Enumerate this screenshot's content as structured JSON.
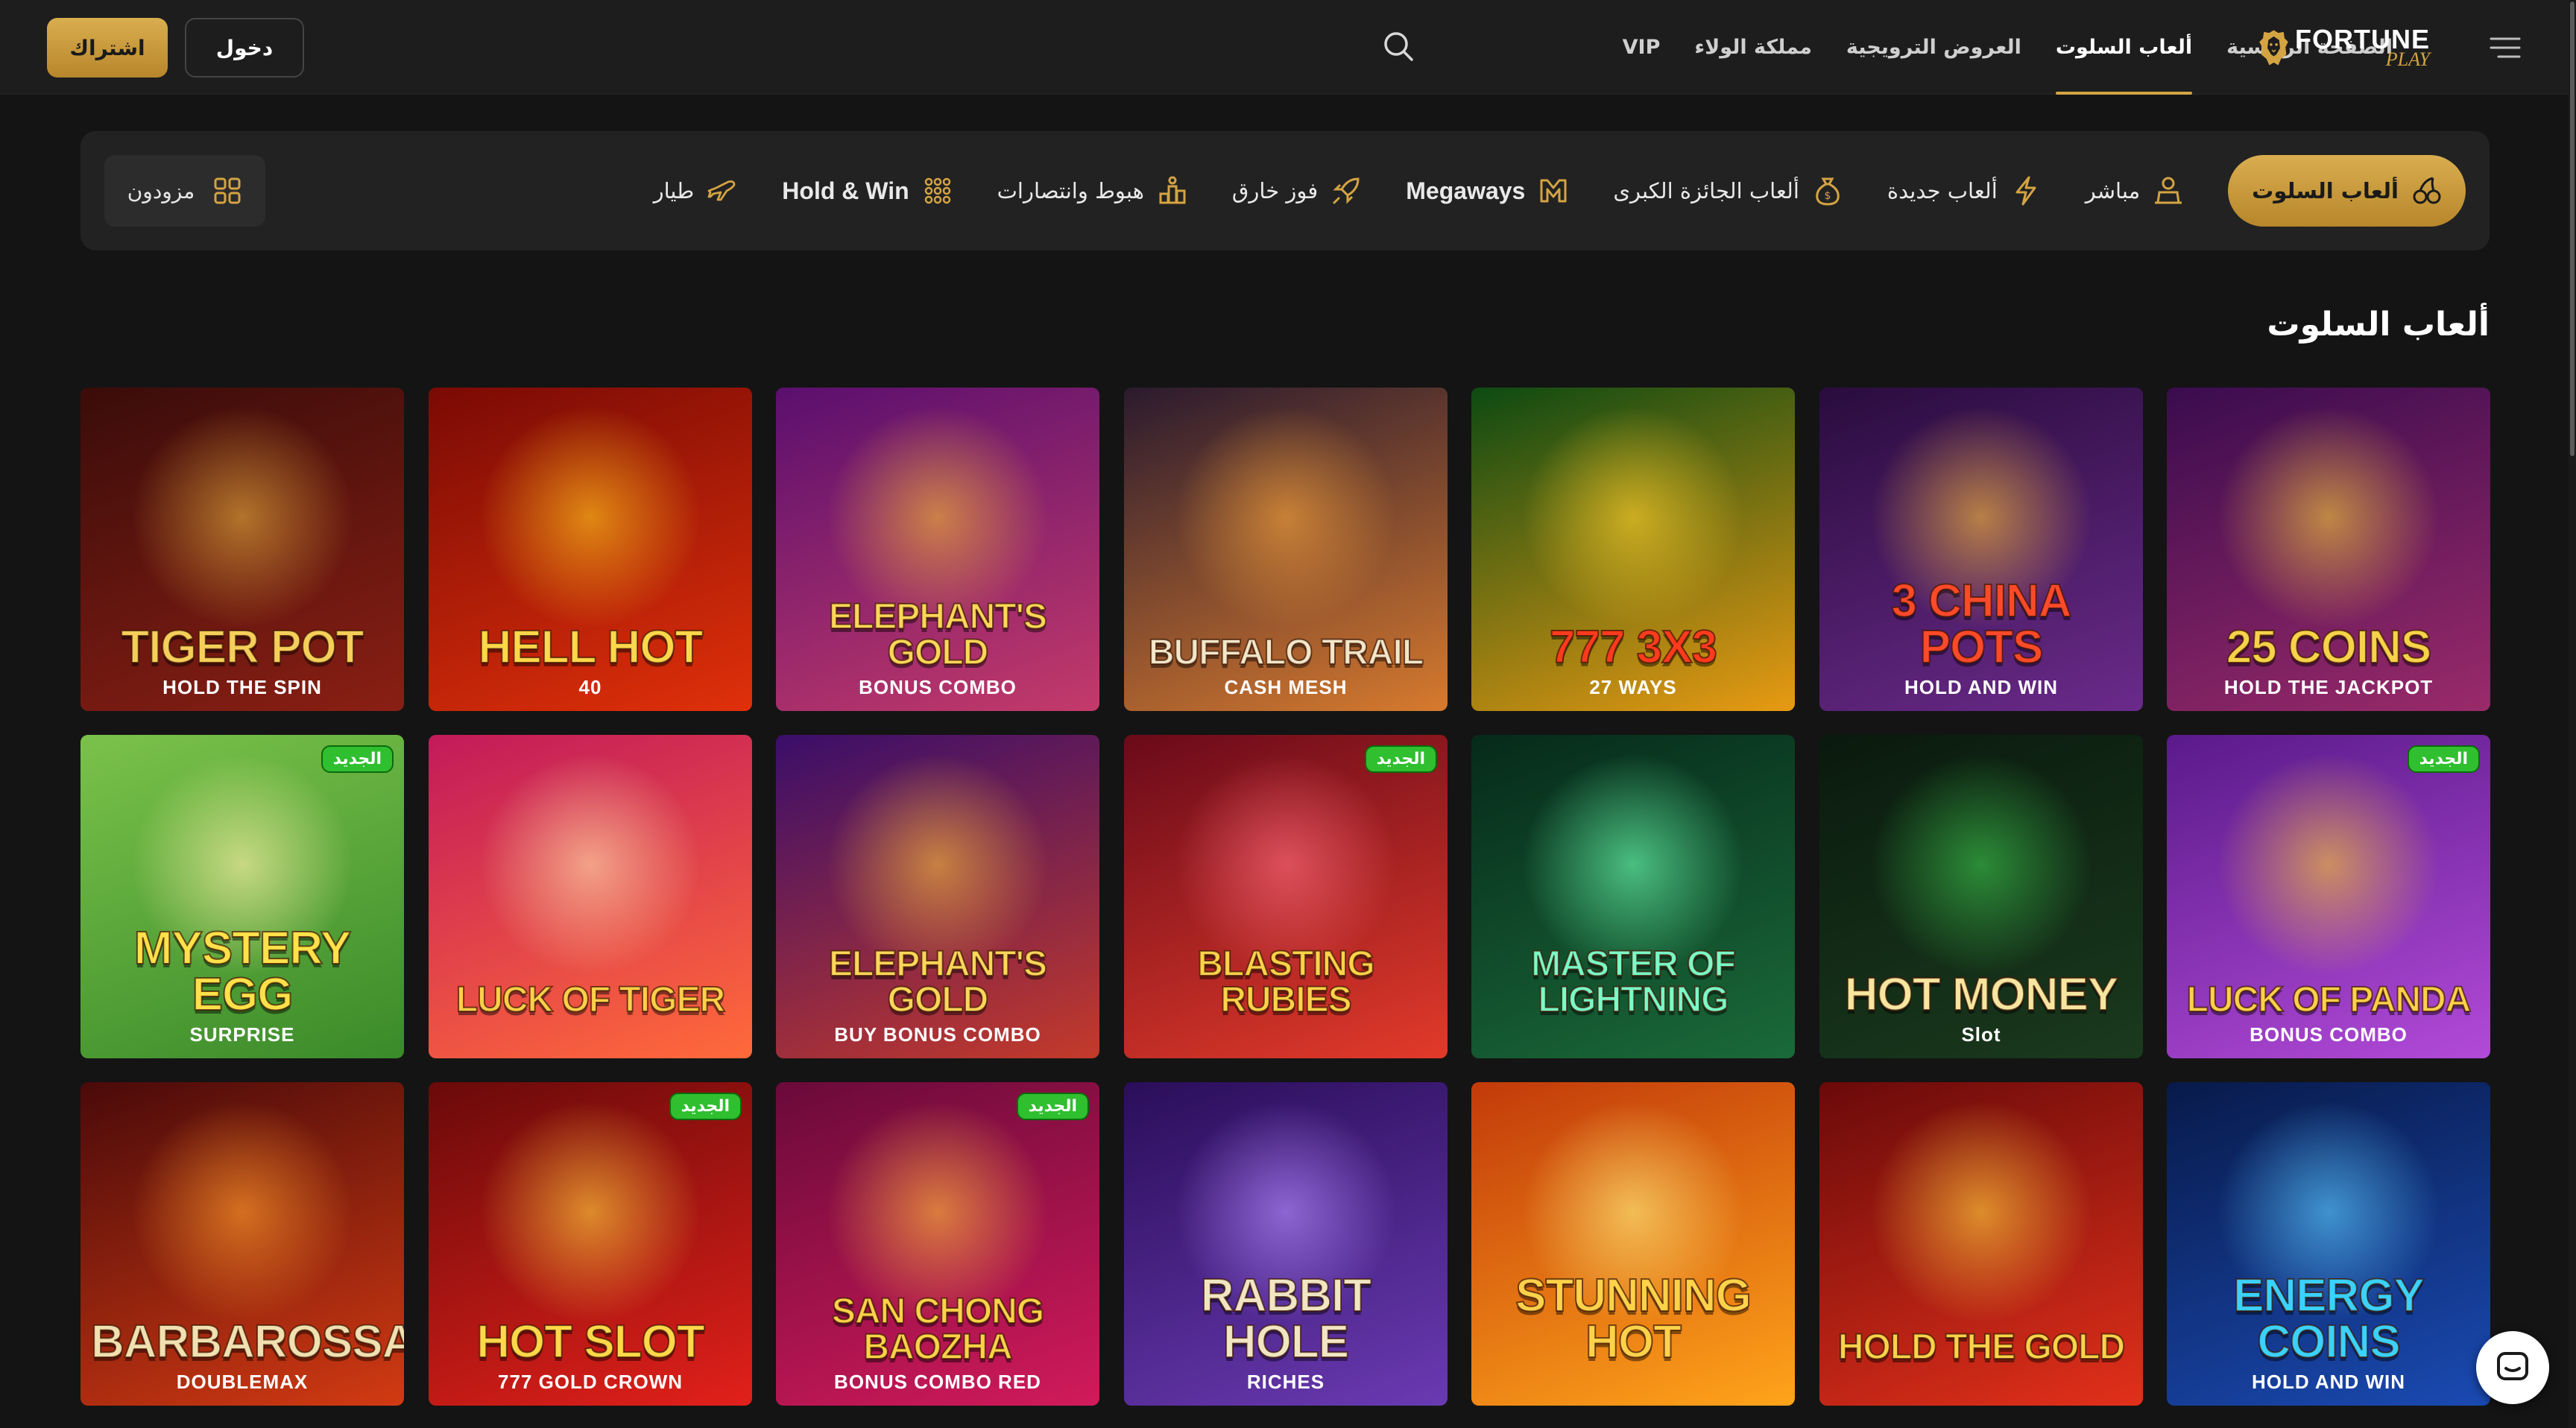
{
  "header": {
    "signup_label": "اشتراك",
    "login_label": "دخول",
    "nav": [
      {
        "label": "الصفحة الرئيسية",
        "active": false
      },
      {
        "label": "ألعاب السلوت",
        "active": true
      },
      {
        "label": "العروض الترويجية",
        "active": false
      },
      {
        "label": "مملكة الولاء",
        "active": false
      },
      {
        "label": "VIP",
        "active": false
      }
    ],
    "logo_line1": "FORTUNE",
    "logo_line2": "PLAY"
  },
  "categories": {
    "items": [
      {
        "label": "ألعاب السلوت",
        "icon": "slot-cherries-icon",
        "active": true
      },
      {
        "label": "مباشر",
        "icon": "live-dealer-icon"
      },
      {
        "label": "ألعاب جديدة",
        "icon": "lightning-icon"
      },
      {
        "label": "ألعاب الجائزة الكبرى",
        "icon": "money-bag-icon"
      },
      {
        "label": "Megaways",
        "icon": "megaways-icon"
      },
      {
        "label": "فوز خارق",
        "icon": "rocket-icon"
      },
      {
        "label": "هبوط وانتصارات",
        "icon": "cascade-icon"
      },
      {
        "label": "Hold & Win",
        "icon": "grid-dots-icon"
      },
      {
        "label": "طيار",
        "icon": "plane-icon"
      }
    ],
    "providers_label": "مزودون"
  },
  "section_title": "ألعاب السلوت",
  "games": [
    {
      "title": "TIGER POT",
      "subtitle": "HOLD THE SPIN",
      "badge": "",
      "bg": [
        "#3a0c0a",
        "#8a1f14"
      ],
      "glow": "#e0a73a",
      "title_color": "#f5cf5a"
    },
    {
      "title": "HELL HOT",
      "subtitle": "40",
      "badge": "",
      "bg": [
        "#7a0a05",
        "#e0300a"
      ],
      "glow": "#ffc21a",
      "title_color": "#ffd84a"
    },
    {
      "title": "ELEPHANT'S GOLD",
      "subtitle": "BONUS COMBO",
      "badge": "",
      "bg": [
        "#5a0f6e",
        "#c43a6a"
      ],
      "glow": "#f0b236",
      "title_color": "#ffd65a"
    },
    {
      "title": "BUFFALO TRAIL",
      "subtitle": "CASH MESH",
      "badge": "",
      "bg": [
        "#2a1a2e",
        "#d77a2e"
      ],
      "glow": "#f4a13a",
      "title_color": "#f3e6c9"
    },
    {
      "title": "777 3X3",
      "subtitle": "27 WAYS",
      "badge": "",
      "bg": [
        "#0d4a12",
        "#e89a12"
      ],
      "glow": "#ffcf2a",
      "title_color": "#ff3b1d"
    },
    {
      "title": "3 CHINA POTS",
      "subtitle": "HOLD AND WIN",
      "badge": "",
      "bg": [
        "#2a0c3e",
        "#6a2a8a"
      ],
      "glow": "#f4b63a",
      "title_color": "#ff4a2a"
    },
    {
      "title": "25 COINS",
      "subtitle": "HOLD THE JACKPOT",
      "badge": "",
      "bg": [
        "#3a0c4e",
        "#9a2a6a"
      ],
      "glow": "#f1c23a",
      "title_color": "#f7d24a"
    },
    {
      "title": "MYSTERY EGG",
      "subtitle": "SURPRISE",
      "badge": "الجديد",
      "bg": [
        "#7ac24a",
        "#3a8a2a"
      ],
      "glow": "#fff2a8",
      "title_color": "#ffe14a"
    },
    {
      "title": "LUCK OF TIGER",
      "subtitle": "",
      "badge": "",
      "bg": [
        "#c21a5a",
        "#ff6a3a"
      ],
      "glow": "#ffd8a8",
      "title_color": "#ffd04a"
    },
    {
      "title": "ELEPHANT'S GOLD",
      "subtitle": "BUY BONUS COMBO",
      "badge": "",
      "bg": [
        "#3a0e6a",
        "#c43a2a"
      ],
      "glow": "#f4b43a",
      "title_color": "#ffd65a"
    },
    {
      "title": "BLASTING RUBIES",
      "subtitle": "",
      "badge": "الجديد",
      "bg": [
        "#6a0a1a",
        "#e23a2a"
      ],
      "glow": "#ff6a7a",
      "title_color": "#ffd24a"
    },
    {
      "title": "MASTER OF LIGHTNING",
      "subtitle": "",
      "badge": "",
      "bg": [
        "#062a1a",
        "#1a6a3a"
      ],
      "glow": "#6affb0",
      "title_color": "#7affc8"
    },
    {
      "title": "HOT MONEY",
      "subtitle": "Slot",
      "badge": "",
      "bg": [
        "#0a1a0e",
        "#1a3a1e"
      ],
      "glow": "#3ac24a",
      "title_color": "#f6e6a0"
    },
    {
      "title": "LUCK OF PANDA",
      "subtitle": "BONUS COMBO",
      "badge": "الجديد",
      "bg": [
        "#5a1a8a",
        "#b24ad8"
      ],
      "glow": "#f4c23a",
      "title_color": "#ffd04a"
    },
    {
      "title": "BARBAROSSA",
      "subtitle": "DOUBLEMAX",
      "badge": "",
      "bg": [
        "#4a0a0a",
        "#d23a12"
      ],
      "glow": "#ff9a2a",
      "title_color": "#f1e0b0"
    },
    {
      "title": "HOT SLOT",
      "subtitle": "777 GOLD CROWN",
      "badge": "الجديد",
      "bg": [
        "#6a0a0a",
        "#e2201a"
      ],
      "glow": "#ffca3a",
      "title_color": "#ffd84a"
    },
    {
      "title": "SAN CHONG BAOZHA",
      "subtitle": "BONUS COMBO RED",
      "badge": "الجديد",
      "bg": [
        "#6a0a3a",
        "#d21a5a"
      ],
      "glow": "#ffb43a",
      "title_color": "#ffd24a"
    },
    {
      "title": "RABBIT HOLE",
      "subtitle": "RICHES",
      "badge": "",
      "bg": [
        "#2a0e5a",
        "#6a3ab2"
      ],
      "glow": "#b48aff",
      "title_color": "#f1e6c4"
    },
    {
      "title": "STUNNING HOT",
      "subtitle": "",
      "badge": "",
      "bg": [
        "#c23a0a",
        "#ffa41a"
      ],
      "glow": "#ffea7a",
      "title_color": "#ffd24a"
    },
    {
      "title": "HOLD THE GOLD",
      "subtitle": "",
      "badge": "",
      "bg": [
        "#6a0a0a",
        "#e2301a"
      ],
      "glow": "#ffca3a",
      "title_color": "#ffd24a"
    },
    {
      "title": "ENERGY COINS",
      "subtitle": "HOLD AND WIN",
      "badge": "",
      "bg": [
        "#081a4a",
        "#1a4ab2"
      ],
      "glow": "#5ac8ff",
      "title_color": "#3ad2ff"
    }
  ],
  "colors": {
    "accent": "#d4a443",
    "background": "#141414",
    "header": "#1d1d1d",
    "new_badge": "#2fbf2f"
  }
}
